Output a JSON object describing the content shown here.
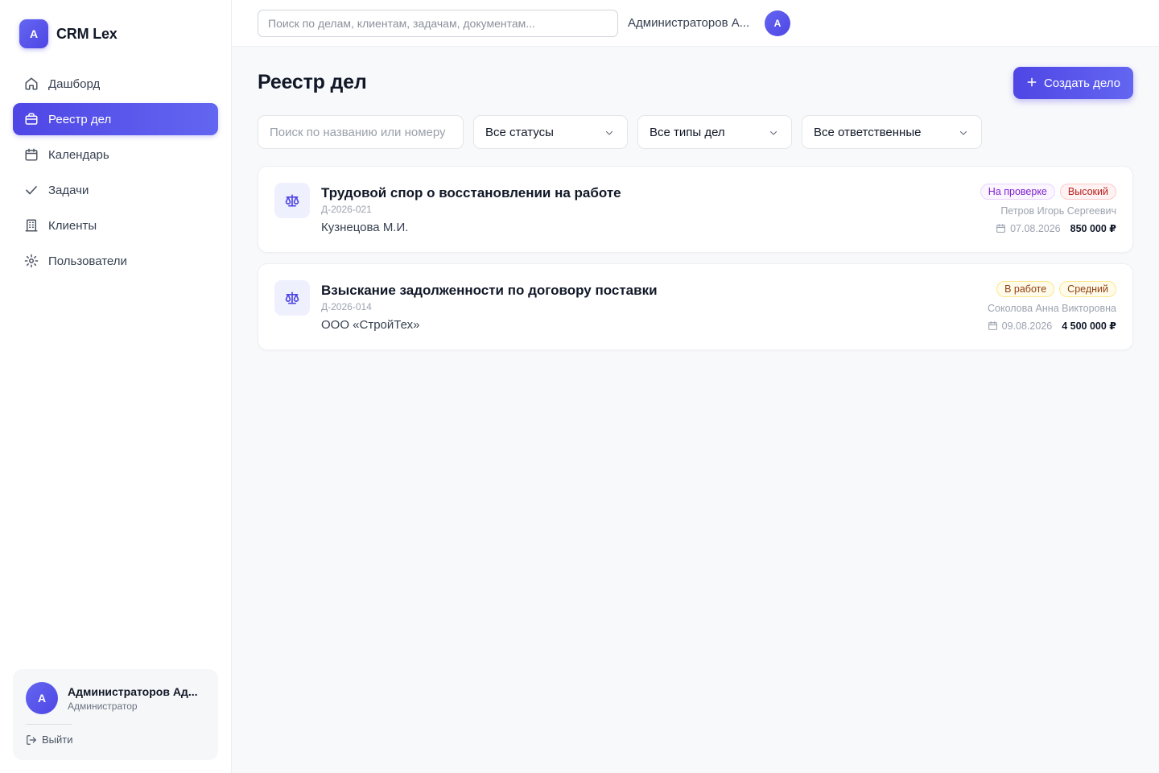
{
  "colors": {
    "accent": "#4f46e5",
    "accent_light": "#6366f1",
    "background": "#f8f9fb"
  },
  "brand": {
    "logo_letter": "A",
    "name": "CRM Lex"
  },
  "sidebar": {
    "items": [
      {
        "label": "Дашборд",
        "icon": "home-icon",
        "active": false
      },
      {
        "label": "Реестр дел",
        "icon": "briefcase-icon",
        "active": true
      },
      {
        "label": "Календарь",
        "icon": "calendar-icon",
        "active": false
      },
      {
        "label": "Задачи",
        "icon": "check-icon",
        "active": false
      },
      {
        "label": "Клиенты",
        "icon": "building-icon",
        "active": false
      },
      {
        "label": "Пользователи",
        "icon": "users-icon",
        "active": false
      }
    ],
    "user": {
      "avatar_letter": "A",
      "name": "Администраторов Ад...",
      "role": "Администратор",
      "logout_label": "Выйти"
    }
  },
  "topbar": {
    "search_placeholder": "Поиск по делам, клиентам, задачам, документам...",
    "user_name": "Администраторов А...",
    "avatar_letter": "A"
  },
  "main": {
    "title": "Реестр дел",
    "create_button": "Создать дело",
    "filters": {
      "search_placeholder": "Поиск по названию или номеру",
      "status": "Все статусы",
      "type": "Все типы дел",
      "responsible": "Все ответственные"
    },
    "cases": [
      {
        "title": "Трудовой спор о восстановлении на работе",
        "number": "Д-2026-021",
        "client": "Кузнецова М.И.",
        "status": {
          "label": "На проверке",
          "bg": "#faf5ff",
          "border": "#e9d5ff",
          "color": "#7e22ce"
        },
        "priority": {
          "label": "Высокий",
          "bg": "#fef2f2",
          "border": "#fecaca",
          "color": "#b91c1c"
        },
        "responsible": "Петров Игорь Сергеевич",
        "date": "07.08.2026",
        "amount": "850 000 ₽"
      },
      {
        "title": "Взыскание задолженности по договору поставки",
        "number": "Д-2026-014",
        "client": "ООО «СтройТех»",
        "status": {
          "label": "В работе",
          "bg": "#fffbeb",
          "border": "#fde68a",
          "color": "#92400e"
        },
        "priority": {
          "label": "Средний",
          "bg": "#fffbeb",
          "border": "#fde68a",
          "color": "#92400e"
        },
        "responsible": "Соколова Анна Викторовна",
        "date": "09.08.2026",
        "amount": "4 500 000 ₽"
      }
    ]
  }
}
